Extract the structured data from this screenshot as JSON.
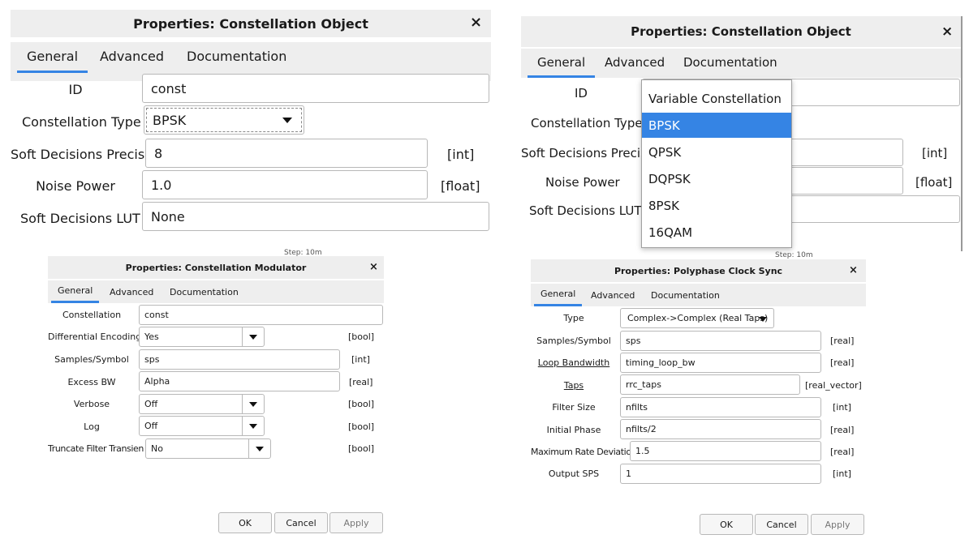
{
  "p1": {
    "title": "Properties: Constellation Object",
    "close": "×",
    "tabs": [
      "General",
      "Advanced",
      "Documentation"
    ],
    "rows": {
      "id_label": "ID",
      "id_value": "const",
      "type_label": "Constellation Type",
      "type_value": "BPSK",
      "sdp_label": "Soft Decisions Precision",
      "sdp_value": "8",
      "sdp_unit": "[int]",
      "noise_label": "Noise Power",
      "noise_value": "1.0",
      "noise_unit": "[float]",
      "lut_label": "Soft Decisions LUT",
      "lut_value": "None"
    }
  },
  "p2": {
    "title": "Properties: Constellation Object",
    "close": "×",
    "tabs": [
      "General",
      "Advanced",
      "Documentation"
    ],
    "rows": {
      "id_label": "ID",
      "type_label": "Constellation Type",
      "sdp_label": "Soft Decisions Precisio",
      "sdp_unit": "[int]",
      "noise_label": "Noise Power",
      "noise_unit": "[float]",
      "lut_label": "Soft Decisions LUT"
    },
    "dropdown_options": [
      "Variable Constellation",
      "BPSK",
      "QPSK",
      "DQPSK",
      "8PSK",
      "16QAM"
    ],
    "selected_option": "BPSK"
  },
  "p3": {
    "title": "Properties: Constellation Modulator",
    "close": "×",
    "tabs": [
      "General",
      "Advanced",
      "Documentation"
    ],
    "rows": [
      {
        "label": "Constellation",
        "value": "const",
        "unit": "",
        "kind": "text"
      },
      {
        "label": "Differential Encoding",
        "value": "Yes",
        "unit": "[bool]",
        "kind": "combo"
      },
      {
        "label": "Samples/Symbol",
        "value": "sps",
        "unit": "[int]",
        "kind": "text"
      },
      {
        "label": "Excess BW",
        "value": "Alpha",
        "unit": "[real]",
        "kind": "text"
      },
      {
        "label": "Verbose",
        "value": "Off",
        "unit": "[bool]",
        "kind": "combo"
      },
      {
        "label": "Log",
        "value": "Off",
        "unit": "[bool]",
        "kind": "combo"
      },
      {
        "label": "Truncate Filter Transient",
        "value": "No",
        "unit": "[bool]",
        "kind": "combo"
      }
    ],
    "buttons": [
      "OK",
      "Cancel",
      "Apply"
    ]
  },
  "p4": {
    "title": "Properties: Polyphase Clock Sync",
    "close": "×",
    "tabs": [
      "General",
      "Advanced",
      "Documentation"
    ],
    "rows": [
      {
        "label": "Type",
        "value": "Complex->Complex (Real Taps)",
        "unit": "",
        "kind": "combo"
      },
      {
        "label": "Samples/Symbol",
        "value": "sps",
        "unit": "[real]",
        "kind": "text"
      },
      {
        "label": "Loop Bandwidth",
        "value": "timing_loop_bw",
        "unit": "[real]",
        "kind": "text"
      },
      {
        "label": "Taps",
        "value": "rrc_taps",
        "unit": "[real_vector]",
        "kind": "text"
      },
      {
        "label": "Filter Size",
        "value": "nfilts",
        "unit": "[int]",
        "kind": "text"
      },
      {
        "label": "Initial Phase",
        "value": "nfilts/2",
        "unit": "[real]",
        "kind": "text"
      },
      {
        "label": "Maximum Rate Deviation",
        "value": "1.5",
        "unit": "[real]",
        "kind": "text"
      },
      {
        "label": "Output SPS",
        "value": "1",
        "unit": "[int]",
        "kind": "text"
      }
    ],
    "buttons": [
      "OK",
      "Cancel",
      "Apply"
    ]
  },
  "bg_fragments": {
    "left": "Step: 10m",
    "right": "Step: 10m"
  }
}
